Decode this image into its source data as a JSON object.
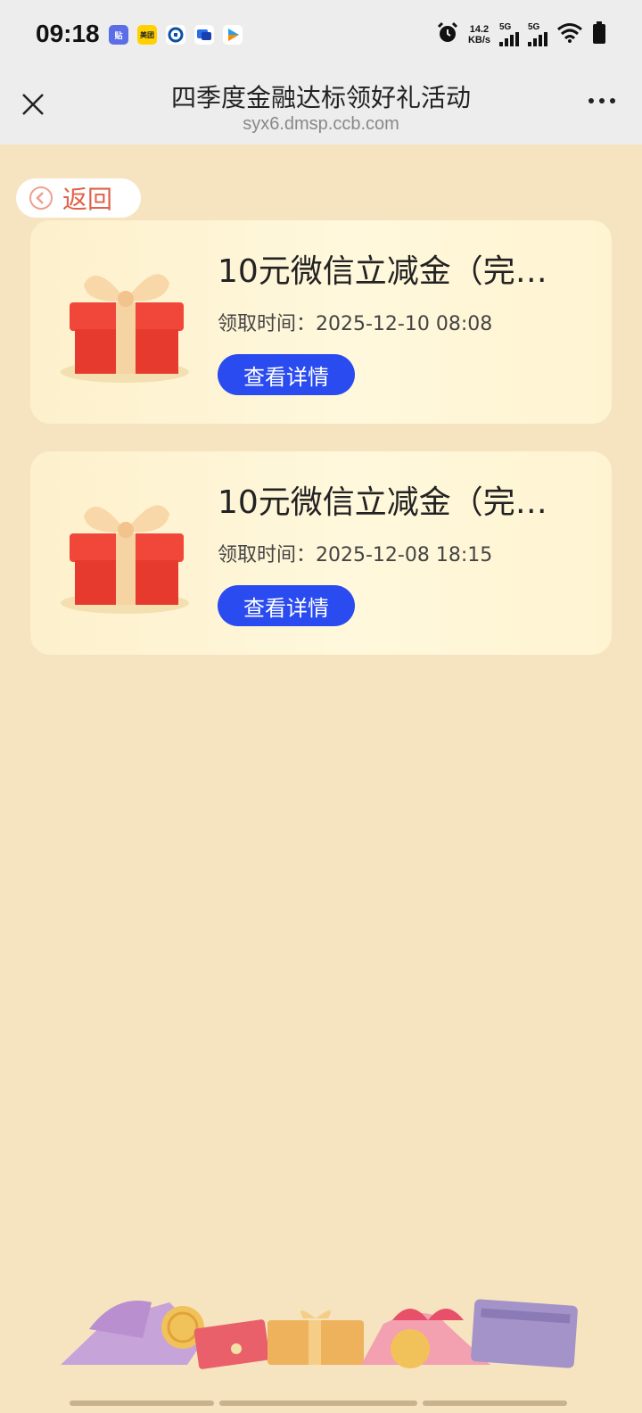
{
  "status_bar": {
    "time": "09:18",
    "net_speed_value": "14.2",
    "net_speed_unit": "KB/s",
    "signal_1_label": "5G",
    "signal_2_label": "5G",
    "app_icons": [
      "tieba-icon",
      "meituan-icon",
      "ccb-icon",
      "message-icon",
      "video-icon"
    ],
    "meituan_label": "美团"
  },
  "header": {
    "title": "四季度金融达标领好礼活动",
    "url": "syx6.dmsp.ccb.com"
  },
  "back": {
    "label": "返回"
  },
  "rewards": [
    {
      "title": "10元微信立减金（完…",
      "time": "领取时间：2025-12-10 08:08",
      "button": "查看详情"
    },
    {
      "title": "10元微信立减金（完…",
      "time": "领取时间：2025-12-08 18:15",
      "button": "查看详情"
    }
  ],
  "colors": {
    "background": "#f6e3bf",
    "accent_button": "#2a4bf0",
    "back_text": "#e0624a"
  }
}
